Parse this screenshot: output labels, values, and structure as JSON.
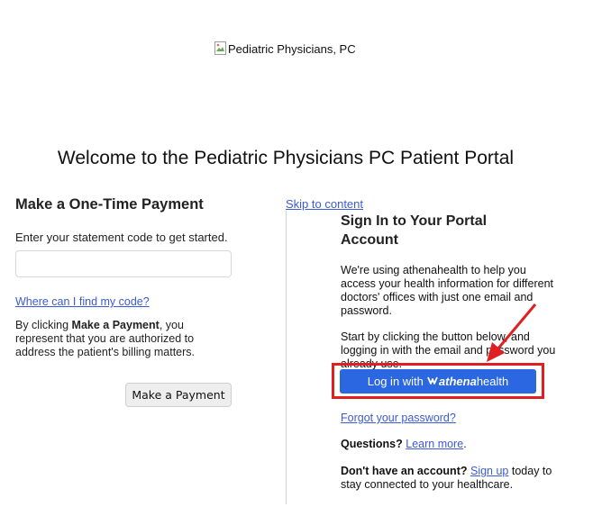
{
  "header": {
    "logo_alt": "Pediatric Physicians, PC",
    "welcome_title": "Welcome to the Pediatric Physicians PC Patient Portal"
  },
  "payment": {
    "heading": "Make a One-Time Payment",
    "instruction": "Enter your statement code to get started.",
    "code_value": "",
    "find_code_link": "Where can I find my code?",
    "disclaimer_prefix": "By clicking ",
    "disclaimer_bold": "Make a Payment",
    "disclaimer_suffix": ", you represent that you are authorized to address the patient's billing matters.",
    "button_label": "Make a Payment"
  },
  "signin": {
    "skip_link": "Skip to content",
    "heading": "Sign In to Your Portal Account",
    "paragraph1": "We're using athenahealth to help you access your health information for different doctors' offices with just one email and password.",
    "paragraph2": "Start by clicking the button below, and logging in with the email and password you already use.",
    "login_prefix": "Log in with",
    "login_brand_a": "athena",
    "login_brand_b": "health",
    "forgot_link": "Forgot your password?",
    "questions_label": "Questions?",
    "learn_more": "Learn more",
    "questions_end": ".",
    "no_account_label": "Don't have an account?",
    "sign_up": "Sign up",
    "no_account_suffix": " today to stay connected to your healthcare."
  },
  "colors": {
    "link": "#3b5bd6",
    "login_button": "#2a67e0",
    "highlight": "#e02020"
  }
}
